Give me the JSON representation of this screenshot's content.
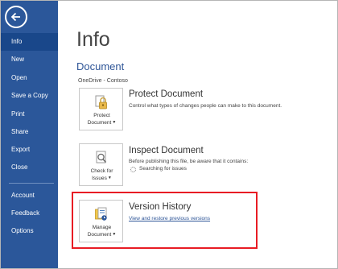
{
  "sidebar": {
    "items": [
      {
        "label": "Info",
        "active": true
      },
      {
        "label": "New"
      },
      {
        "label": "Open"
      },
      {
        "label": "Save a Copy"
      },
      {
        "label": "Print"
      },
      {
        "label": "Share"
      },
      {
        "label": "Export"
      },
      {
        "label": "Close"
      },
      {
        "label": "Account"
      },
      {
        "label": "Feedback"
      },
      {
        "label": "Options"
      }
    ]
  },
  "main": {
    "title": "Info",
    "document_heading": "Document",
    "location": "OneDrive - Contoso",
    "protect": {
      "button_line1": "Protect",
      "button_line2": "Document",
      "title": "Protect Document",
      "description": "Control what types of changes people can make to this document."
    },
    "inspect": {
      "button_line1": "Check for",
      "button_line2": "Issues",
      "title": "Inspect Document",
      "description": "Before publishing this file, be aware that it contains:",
      "status": "Searching for issues"
    },
    "version": {
      "button_line1": "Manage",
      "button_line2": "Document",
      "title": "Version History",
      "link": "View and restore previous versions"
    }
  },
  "colors": {
    "sidebar": "#2b579a",
    "active_item": "#19478a",
    "accent": "#2e5597",
    "highlight": "#e81c24"
  },
  "icons": [
    "back-arrow-icon",
    "lock-key-icon",
    "magnifier-document-icon",
    "manage-document-icon",
    "dropdown-caret-icon"
  ]
}
